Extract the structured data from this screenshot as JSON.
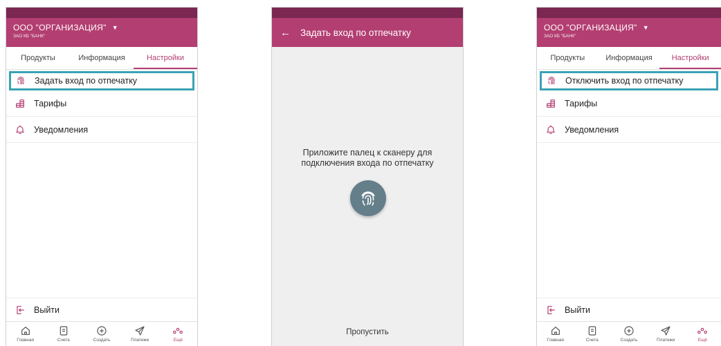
{
  "colors": {
    "brand": "#b33e72",
    "status_bar": "#7a2752",
    "highlight": "#3aa2b5",
    "fingerprint_circle": "#647e8a"
  },
  "screens": [
    {
      "org_name": "ООО \"ОРГАНИЗАЦИЯ\"",
      "org_sub": "ЗАО КБ \"БАНК\"",
      "tabs": [
        {
          "label": "Продукты",
          "active": false
        },
        {
          "label": "Информация",
          "active": false
        },
        {
          "label": "Настройки",
          "active": true
        }
      ],
      "menu": [
        {
          "label": "Задать вход по отпечатку",
          "icon": "fingerprint-icon",
          "highlighted": true
        },
        {
          "label": "Тарифы",
          "icon": "coins-icon"
        },
        {
          "label": "Уведомления",
          "icon": "bell-icon"
        }
      ],
      "logout": "Выйти",
      "bottom_nav": [
        {
          "label": "Главная",
          "icon": "home-icon"
        },
        {
          "label": "Счета",
          "icon": "document-icon"
        },
        {
          "label": "Создать",
          "icon": "plus-circle-icon"
        },
        {
          "label": "Платежи",
          "icon": "paper-plane-icon"
        },
        {
          "label": "Ещё",
          "icon": "more-dots-icon",
          "active": true
        }
      ]
    },
    {
      "title": "Задать вход по отпечатку",
      "instruction_line1": "Приложите палец к сканеру для",
      "instruction_line2": "подключения входа по отпечатку",
      "skip_label": "Пропустить"
    },
    {
      "org_name": "ООО \"ОРГАНИЗАЦИЯ\"",
      "org_sub": "ЗАО КБ \"БАНК\"",
      "tabs": [
        {
          "label": "Продукты",
          "active": false
        },
        {
          "label": "Информация",
          "active": false
        },
        {
          "label": "Настройки",
          "active": true
        }
      ],
      "menu": [
        {
          "label": "Отключить вход по отпечатку",
          "icon": "fingerprint-icon",
          "highlighted": true
        },
        {
          "label": "Тарифы",
          "icon": "coins-icon"
        },
        {
          "label": "Уведомления",
          "icon": "bell-icon"
        }
      ],
      "logout": "Выйти",
      "bottom_nav": [
        {
          "label": "Главная",
          "icon": "home-icon"
        },
        {
          "label": "Счета",
          "icon": "document-icon"
        },
        {
          "label": "Создать",
          "icon": "plus-circle-icon"
        },
        {
          "label": "Платежи",
          "icon": "paper-plane-icon"
        },
        {
          "label": "Ещё",
          "icon": "more-dots-icon",
          "active": true
        }
      ]
    }
  ]
}
